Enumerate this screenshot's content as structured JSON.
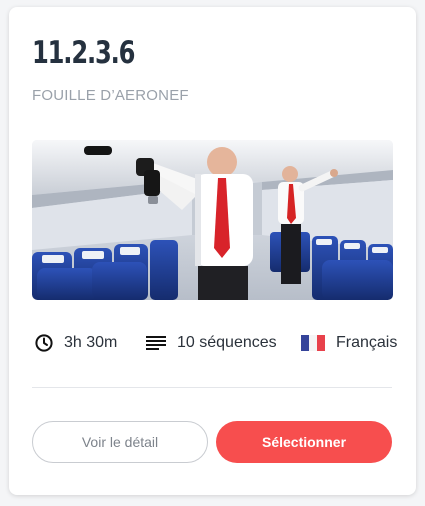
{
  "course": {
    "code": "11.2.3.6",
    "name": "FOUILLE D’AERONEF",
    "image_alt": "Personnel de cabine inspectant les coffres à bagages d'un avion"
  },
  "meta": {
    "duration": "3h 30m",
    "sequences": "10 séquences",
    "language": "Français",
    "icons": {
      "duration": "clock-icon",
      "sequences": "list-lines-icon",
      "language": "french-flag-icon"
    }
  },
  "actions": {
    "detail_label": "Voir le détail",
    "select_label": "Sélectionner"
  },
  "colors": {
    "title": "#25313f",
    "subtitle": "#9aa1aa",
    "accent": "#f74e4e",
    "seat_blue": "#1f3f9a"
  }
}
